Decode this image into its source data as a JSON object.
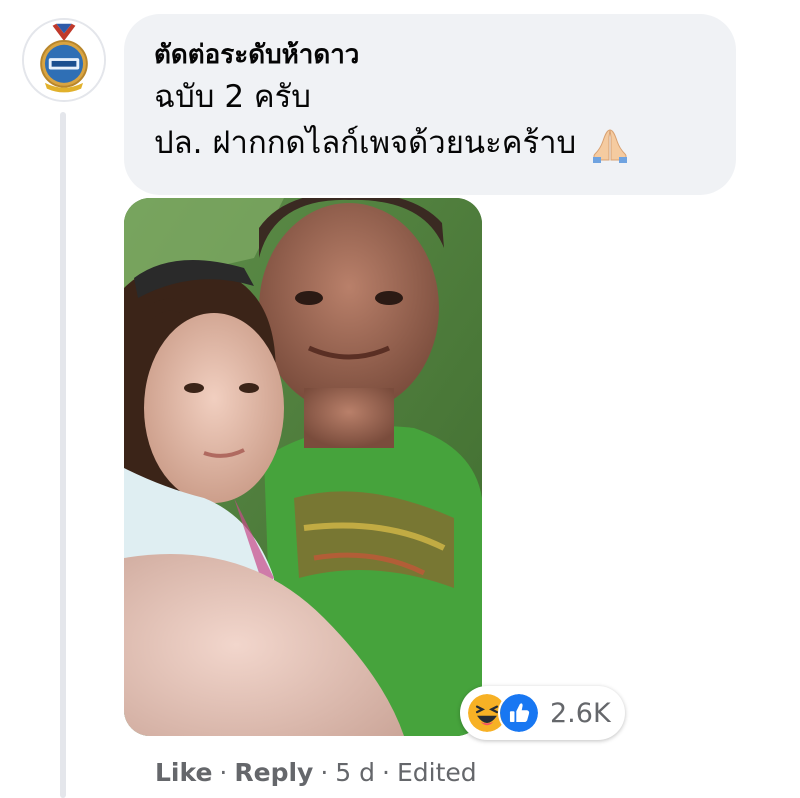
{
  "comment": {
    "author": "ตัดต่อระดับห้าดาว",
    "lines": [
      "ฉบับ 2 ครับ",
      "ปล. ฝากกดไลก์เพจด้วยนะคร้าบ"
    ],
    "trailing_emoji": "folded-hands-icon"
  },
  "reactions": {
    "types": [
      "haha-icon",
      "like-icon"
    ],
    "count": "2.6K"
  },
  "actions": {
    "like_label": "Like",
    "reply_label": "Reply",
    "age": "5 d",
    "edited_label": "Edited",
    "separator": "·"
  },
  "colors": {
    "bubble_bg": "#f0f2f5",
    "text_primary": "#050505",
    "text_secondary": "#65676b",
    "like_blue": "#1877f2",
    "haha_yellow": "#f7b125"
  }
}
